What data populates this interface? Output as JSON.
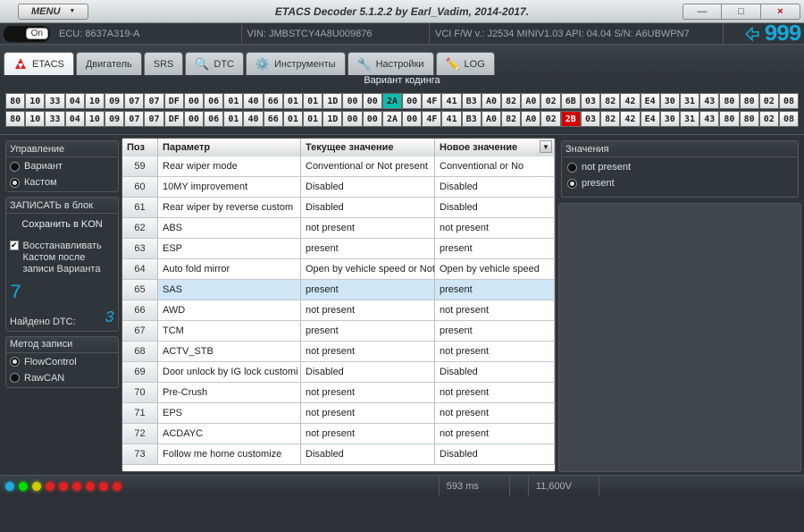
{
  "titlebar": {
    "menu": "MENU",
    "title": "ETACS Decoder 5.1.2.2 by Earl_Vadim, 2014-2017.",
    "min": "—",
    "max": "□",
    "close": "×"
  },
  "infobar": {
    "on": "On",
    "ecu": "ECU: 8637A319-A",
    "vin": "VIN: JMBSTCY4A8U009876",
    "vci": "VCI F/W v.: J2534 MINIV1.03 API: 04.04 S/N: A6UBWPN7",
    "logo_num": "999"
  },
  "tabs": {
    "etacs": "ETACS",
    "engine": "Двигатель",
    "srs": "SRS",
    "dtc": "DTC",
    "tools": "Инструменты",
    "settings": "Настройки",
    "log": "LOG"
  },
  "variant_header": "Вариант кодинга",
  "bytes_row1": [
    {
      "v": "80"
    },
    {
      "v": "10"
    },
    {
      "v": "33"
    },
    {
      "v": "04"
    },
    {
      "v": "10"
    },
    {
      "v": "09"
    },
    {
      "v": "07"
    },
    {
      "v": "07"
    },
    {
      "v": "DF"
    },
    {
      "v": "00"
    },
    {
      "v": "06"
    },
    {
      "v": "01"
    },
    {
      "v": "40"
    },
    {
      "v": "66"
    },
    {
      "v": "01"
    },
    {
      "v": "01"
    },
    {
      "v": "1D"
    },
    {
      "v": "00"
    },
    {
      "v": "00"
    },
    {
      "v": "2A",
      "cls": "teal"
    },
    {
      "v": "00"
    },
    {
      "v": "4F"
    },
    {
      "v": "41"
    },
    {
      "v": "B3"
    },
    {
      "v": "A0"
    },
    {
      "v": "82"
    },
    {
      "v": "A0"
    },
    {
      "v": "02"
    },
    {
      "v": "6B"
    },
    {
      "v": "03"
    },
    {
      "v": "82"
    },
    {
      "v": "42"
    },
    {
      "v": "E4"
    },
    {
      "v": "30"
    },
    {
      "v": "31"
    },
    {
      "v": "43"
    },
    {
      "v": "80"
    },
    {
      "v": "80"
    },
    {
      "v": "02"
    },
    {
      "v": "08"
    }
  ],
  "bytes_row2": [
    {
      "v": "80"
    },
    {
      "v": "10"
    },
    {
      "v": "33"
    },
    {
      "v": "04"
    },
    {
      "v": "10"
    },
    {
      "v": "09"
    },
    {
      "v": "07"
    },
    {
      "v": "07"
    },
    {
      "v": "DF"
    },
    {
      "v": "00"
    },
    {
      "v": "06"
    },
    {
      "v": "01"
    },
    {
      "v": "40"
    },
    {
      "v": "66"
    },
    {
      "v": "01"
    },
    {
      "v": "01"
    },
    {
      "v": "1D"
    },
    {
      "v": "00"
    },
    {
      "v": "00"
    },
    {
      "v": "2A"
    },
    {
      "v": "00"
    },
    {
      "v": "4F"
    },
    {
      "v": "41"
    },
    {
      "v": "B3"
    },
    {
      "v": "A0"
    },
    {
      "v": "82"
    },
    {
      "v": "A0"
    },
    {
      "v": "02"
    },
    {
      "v": "2B",
      "cls": "red"
    },
    {
      "v": "03"
    },
    {
      "v": "82"
    },
    {
      "v": "42"
    },
    {
      "v": "E4"
    },
    {
      "v": "30"
    },
    {
      "v": "31"
    },
    {
      "v": "43"
    },
    {
      "v": "80"
    },
    {
      "v": "80"
    },
    {
      "v": "02"
    },
    {
      "v": "08"
    }
  ],
  "sidebar": {
    "panel1": "Управление",
    "opt_variant": "Вариант",
    "opt_custom": "Кастом",
    "panel2": "ЗАПИСАТЬ в блок",
    "save_to": "Сохранить в KON",
    "restore": "Восстанавливать Кастом после записи Варианта",
    "found_dtc_label": "Найдено DTC:",
    "found_dtc": "3",
    "panel3": "Метод записи",
    "opt_flow": "FlowControl",
    "opt_raw": "RawCAN"
  },
  "grid": {
    "col_pos": "Поз",
    "col_param": "Параметр",
    "col_cur": "Текущее значение",
    "col_new": "Новое значение",
    "rows": [
      {
        "pos": "59",
        "param": "Rear wiper mode",
        "cur": "Conventional or Not present",
        "new": "Conventional or No"
      },
      {
        "pos": "60",
        "param": "10MY improvement",
        "cur": "Disabled",
        "new": "Disabled"
      },
      {
        "pos": "61",
        "param": "Rear wiper by reverse custom",
        "cur": "Disabled",
        "new": "Disabled"
      },
      {
        "pos": "62",
        "param": "ABS",
        "cur": "not present",
        "new": "not present"
      },
      {
        "pos": "63",
        "param": "ESP",
        "cur": "present",
        "new": "present"
      },
      {
        "pos": "64",
        "param": "Auto fold mirror",
        "cur": "Open by vehicle speed or Not",
        "new": "Open by vehicle speed"
      },
      {
        "pos": "65",
        "param": "SAS",
        "cur": "present",
        "new": "present",
        "sel": true
      },
      {
        "pos": "66",
        "param": "AWD",
        "cur": "not present",
        "new": "not present"
      },
      {
        "pos": "67",
        "param": "TCM",
        "cur": "present",
        "new": "present"
      },
      {
        "pos": "68",
        "param": "ACTV_STB",
        "cur": "not present",
        "new": "not present"
      },
      {
        "pos": "69",
        "param": "Door unlock by IG lock customi",
        "cur": "Disabled",
        "new": "Disabled"
      },
      {
        "pos": "70",
        "param": "Pre-Crush",
        "cur": "not present",
        "new": "not present"
      },
      {
        "pos": "71",
        "param": "EPS",
        "cur": "not present",
        "new": "not present"
      },
      {
        "pos": "72",
        "param": "ACDAYC",
        "cur": "not present",
        "new": "not present"
      },
      {
        "pos": "73",
        "param": "Follow me home customize",
        "cur": "Disabled",
        "new": "Disabled"
      }
    ]
  },
  "values_panel": {
    "title": "Значения",
    "opt1": "not present",
    "opt2": "present"
  },
  "status": {
    "leds": [
      "blue",
      "green",
      "yellow",
      "red",
      "red",
      "red",
      "red",
      "red",
      "red"
    ],
    "ms": "593 ms",
    "volt": "11,600V"
  }
}
